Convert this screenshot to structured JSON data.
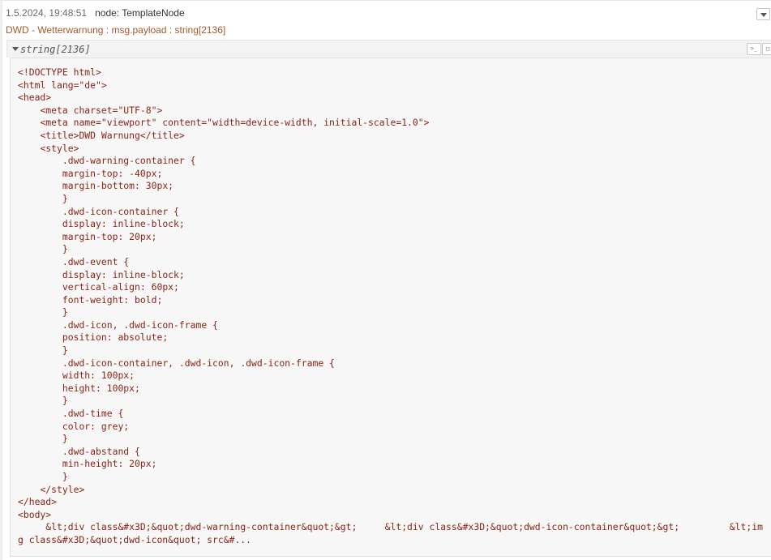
{
  "message": {
    "timestamp": "1.5.2024, 19:48:51",
    "node_prefix": "node: ",
    "node_name": "TemplateNode",
    "topic_line": "DWD - Wetterwarnung : msg.payload : string[2136]"
  },
  "value": {
    "type_label": "string[2136]",
    "content": "<!DOCTYPE html>\n<html lang=\"de\">\n<head>\n    <meta charset=\"UTF-8\">\n    <meta name=\"viewport\" content=\"width=device-width, initial-scale=1.0\">\n    <title>DWD Warnung</title>\n    <style>\n        .dwd-warning-container {\n        margin-top: -40px;\n        margin-bottom: 30px;\n        }\n        .dwd-icon-container {\n        display: inline-block;\n        margin-top: 20px;\n        }\n        .dwd-event {\n        display: inline-block;\n        vertical-align: 60px;\n        font-weight: bold;\n        }\n        .dwd-icon, .dwd-icon-frame {\n        position: absolute;\n        }\n        .dwd-icon-container, .dwd-icon, .dwd-icon-frame {\n        width: 100px;\n        height: 100px;\n        }\n        .dwd-time {\n        color: grey;\n        }\n        .dwd-abstand {\n        min-height: 20px;\n        }\n    </style>\n</head>\n<body>\n     &lt;div class&#x3D;&quot;dwd-warning-container&quot;&gt;     &lt;div class&#x3D;&quot;dwd-icon-container&quot;&gt;         &lt;img class&#x3D;&quot;dwd-icon&quot; src&#..."
  },
  "icons": {
    "expand": "chevron-down-icon",
    "collapse": "caret-down-icon",
    "copy_path": "terminal-icon",
    "copy_value": "copy-icon"
  },
  "colors": {
    "topic": "#a45a2a",
    "code_text": "#8a2415",
    "panel_bg": "#f7f7f7"
  }
}
